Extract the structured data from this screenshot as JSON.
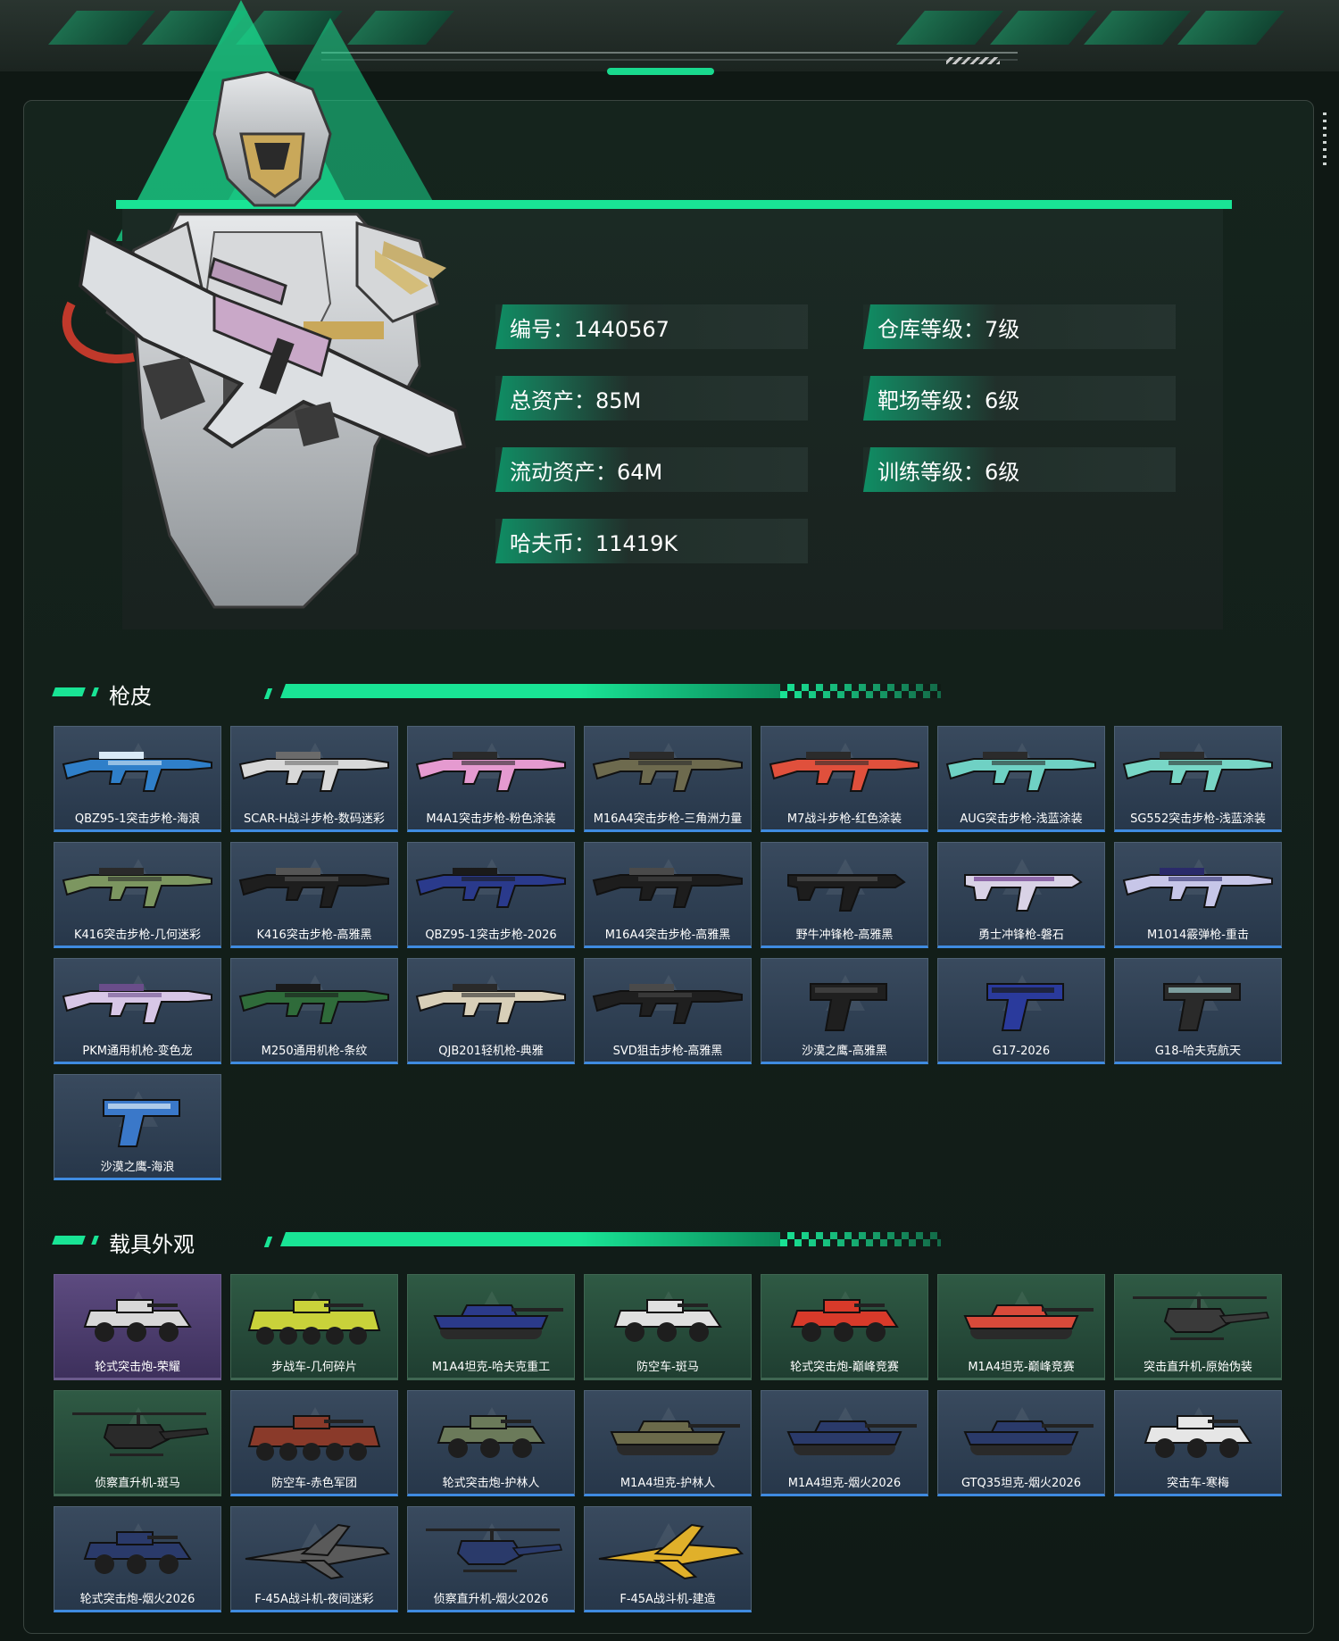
{
  "profile": {
    "id_text": "编号：1440567",
    "total_assets_text": "总资产：85M",
    "liquid_assets_text": "流动资产：64M",
    "coins_text": "哈夫币：11419K",
    "warehouse_level_text": "仓库等级：7级",
    "range_level_text": "靶场等级：6级",
    "training_level_text": "训练等级：6级"
  },
  "sections": {
    "weapons_title": "枪皮",
    "vehicles_title": "载具外观"
  },
  "weapon_skins": [
    {
      "label": "QBZ95-1突击步枪-海浪",
      "kind": "rifle",
      "color": "#2f7fc9",
      "accent": "#d9eaf7"
    },
    {
      "label": "SCAR-H战斗步枪-数码迷彩",
      "kind": "rifle",
      "color": "#d8d8d8",
      "accent": "#6b6b6b"
    },
    {
      "label": "M4A1突击步枪-粉色涂装",
      "kind": "rifle",
      "color": "#e59ad0",
      "accent": "#2a2a2a"
    },
    {
      "label": "M16A4突击步枪-三角洲力量",
      "kind": "rifle",
      "color": "#6d6a4e",
      "accent": "#2b2b2b"
    },
    {
      "label": "M7战斗步枪-红色涂装",
      "kind": "rifle",
      "color": "#e0503c",
      "accent": "#2b2b2b"
    },
    {
      "label": "AUG突击步枪-浅蓝涂装",
      "kind": "rifle",
      "color": "#6fd1c4",
      "accent": "#2b2b2b"
    },
    {
      "label": "SG552突击步枪-浅蓝涂装",
      "kind": "rifle",
      "color": "#78d6c6",
      "accent": "#2b2b2b"
    },
    {
      "label": "K416突击步枪-几何迷彩",
      "kind": "rifle",
      "color": "#7c9660",
      "accent": "#2a2a2a"
    },
    {
      "label": "K416突击步枪-高雅黑",
      "kind": "rifle",
      "color": "#1e1e1e",
      "accent": "#555555"
    },
    {
      "label": "QBZ95-1突击步枪-2026",
      "kind": "rifle",
      "color": "#2a3a8c",
      "accent": "#1a1a1a"
    },
    {
      "label": "M16A4突击步枪-高雅黑",
      "kind": "rifle",
      "color": "#1d1d1d",
      "accent": "#4a4a4a"
    },
    {
      "label": "野牛冲锋枪-高雅黑",
      "kind": "smg",
      "color": "#1d1d1d",
      "accent": "#4a4a4a"
    },
    {
      "label": "勇士冲锋枪-磐石",
      "kind": "smg",
      "color": "#d9d2e6",
      "accent": "#7a4e9a"
    },
    {
      "label": "M1014霰弹枪-重击",
      "kind": "rifle",
      "color": "#c7c6e8",
      "accent": "#2a2a6a"
    },
    {
      "label": "PKM通用机枪-变色龙",
      "kind": "rifle",
      "color": "#d7c6e6",
      "accent": "#6a4d8a"
    },
    {
      "label": "M250通用机枪-条纹",
      "kind": "rifle",
      "color": "#2f6b3a",
      "accent": "#1a1a1a"
    },
    {
      "label": "QJB201轻机枪-典雅",
      "kind": "rifle",
      "color": "#d8cfb8",
      "accent": "#2a2a2a"
    },
    {
      "label": "SVD狙击步枪-高雅黑",
      "kind": "rifle",
      "color": "#1f1f1f",
      "accent": "#4a4a4a"
    },
    {
      "label": "沙漠之鹰-高雅黑",
      "kind": "pistol",
      "color": "#1f1f1f",
      "accent": "#4a4a4a"
    },
    {
      "label": "G17-2026",
      "kind": "pistol",
      "color": "#2a3a9c",
      "accent": "#1a1a1a"
    },
    {
      "label": "G18-哈夫克航天",
      "kind": "pistol",
      "color": "#2a2a2a",
      "accent": "#9fcfcf"
    },
    {
      "label": "沙漠之鹰-海浪",
      "kind": "pistol",
      "color": "#3a78c9",
      "accent": "#e0eef8"
    }
  ],
  "vehicle_skins": [
    {
      "label": "轮式突击炮-荣耀",
      "kind": "car",
      "tone": "purple",
      "color": "#d8d8d8"
    },
    {
      "label": "步战车-几何碎片",
      "kind": "apc",
      "tone": "green",
      "color": "#c9d23a"
    },
    {
      "label": "M1A4坦克-哈夫克重工",
      "kind": "tank",
      "tone": "green",
      "color": "#2b3a8a"
    },
    {
      "label": "防空车-斑马",
      "kind": "car",
      "tone": "green",
      "color": "#e0e0e0"
    },
    {
      "label": "轮式突击炮-巅峰竞赛",
      "kind": "car",
      "tone": "green",
      "color": "#d83a2a"
    },
    {
      "label": "M1A4坦克-巅峰竞赛",
      "kind": "tank",
      "tone": "green",
      "color": "#d84a3a"
    },
    {
      "label": "突击直升机-原始伪装",
      "kind": "heli",
      "tone": "green",
      "color": "#3a3a3a"
    },
    {
      "label": "侦察直升机-斑马",
      "kind": "heli",
      "tone": "green",
      "color": "#2a2a2a"
    },
    {
      "label": "防空车-赤色军团",
      "kind": "apc",
      "tone": "blue",
      "color": "#8a3a2a"
    },
    {
      "label": "轮式突击炮-护林人",
      "kind": "car",
      "tone": "blue",
      "color": "#6b7a5a"
    },
    {
      "label": "M1A4坦克-护林人",
      "kind": "tank",
      "tone": "blue",
      "color": "#6b6a4a"
    },
    {
      "label": "M1A4坦克-烟火2026",
      "kind": "tank",
      "tone": "blue",
      "color": "#2a3a6a"
    },
    {
      "label": "GTQ35坦克-烟火2026",
      "kind": "tank",
      "tone": "blue",
      "color": "#2a3a6a"
    },
    {
      "label": "突击车-寒梅",
      "kind": "car",
      "tone": "blue",
      "color": "#e6e6e6"
    },
    {
      "label": "轮式突击炮-烟火2026",
      "kind": "car",
      "tone": "blue",
      "color": "#2a3a6a"
    },
    {
      "label": "F-45A战斗机-夜间迷彩",
      "kind": "jet",
      "tone": "blue",
      "color": "#5a5a5a"
    },
    {
      "label": "侦察直升机-烟火2026",
      "kind": "heli",
      "tone": "blue",
      "color": "#2a3a6a"
    },
    {
      "label": "F-45A战斗机-建造",
      "kind": "jet",
      "tone": "blue",
      "color": "#e0b02a"
    }
  ]
}
